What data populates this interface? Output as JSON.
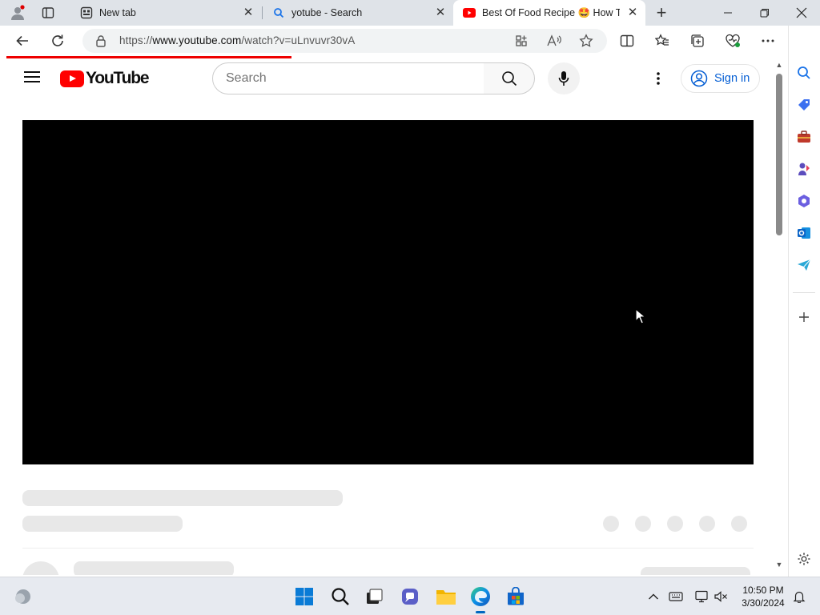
{
  "browser": {
    "tabs": [
      {
        "label": "New tab",
        "icon": "new-tab-page-icon",
        "active": false
      },
      {
        "label": "yotube - Search",
        "icon": "search-icon",
        "active": false
      },
      {
        "label": "Best Of Food Recipe 🤩 How To",
        "icon": "youtube-icon",
        "active": true
      }
    ],
    "new_tab_symbol": "+",
    "close_symbol": "✕",
    "address": {
      "url_prefix": "https://",
      "url_domain": "www.youtube.com",
      "url_path": "/watch?v=uLnvuvr30vA"
    }
  },
  "youtube": {
    "logo_text": "YouTube",
    "search_placeholder": "Search",
    "signin_label": "Sign in"
  },
  "taskbar": {
    "time": "10:50 PM",
    "date": "3/30/2024"
  },
  "colors": {
    "youtube_red": "#ff0000",
    "signin_blue": "#065fd4",
    "edge_accent": "#0067c0"
  }
}
